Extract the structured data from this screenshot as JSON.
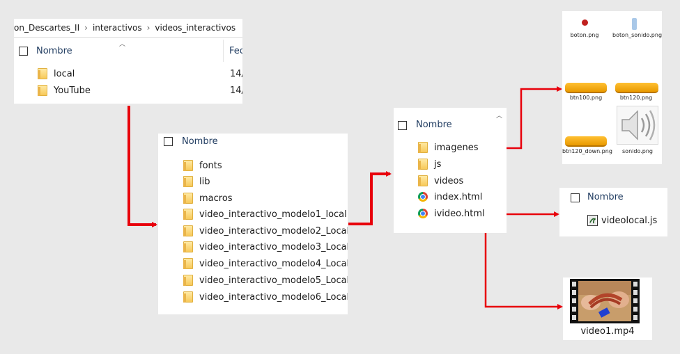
{
  "explorer_top": {
    "breadcrumb": [
      "on_Descartes_II",
      "interactivos",
      "videos_interactivos"
    ],
    "breadcrumb_sep": "›",
    "col_name": "Nombre",
    "col_date": "Fec",
    "items": [
      {
        "name": "local",
        "date": "14/"
      },
      {
        "name": "YouTube",
        "date": "14/"
      }
    ]
  },
  "explorer_local": {
    "col_name": "Nombre",
    "items": [
      "fonts",
      "lib",
      "macros",
      "video_interactivo_modelo1_local",
      "video_interactivo_modelo2_Local",
      "video_interactivo_modelo3_Local",
      "video_interactivo_modelo4_Local",
      "video_interactivo_modelo5_Local",
      "video_interactivo_modelo6_Local"
    ]
  },
  "explorer_modelo": {
    "col_name": "Nombre",
    "folders": [
      "imagenes",
      "js",
      "videos"
    ],
    "files": [
      "index.html",
      "ivideo.html"
    ]
  },
  "imagenes_panel": {
    "files": [
      "boton.png",
      "boton_sonido.png",
      "btn100.png",
      "btn120.png",
      "btn120_down.png",
      "sonido.png"
    ]
  },
  "js_panel": {
    "col_name": "Nombre",
    "file": "videolocal.js"
  },
  "videos_panel": {
    "file": "video1.mp4"
  },
  "colors": {
    "arrow": "#e8000b",
    "folder": "#f7c95a",
    "header_text": "#1e3a5f"
  }
}
